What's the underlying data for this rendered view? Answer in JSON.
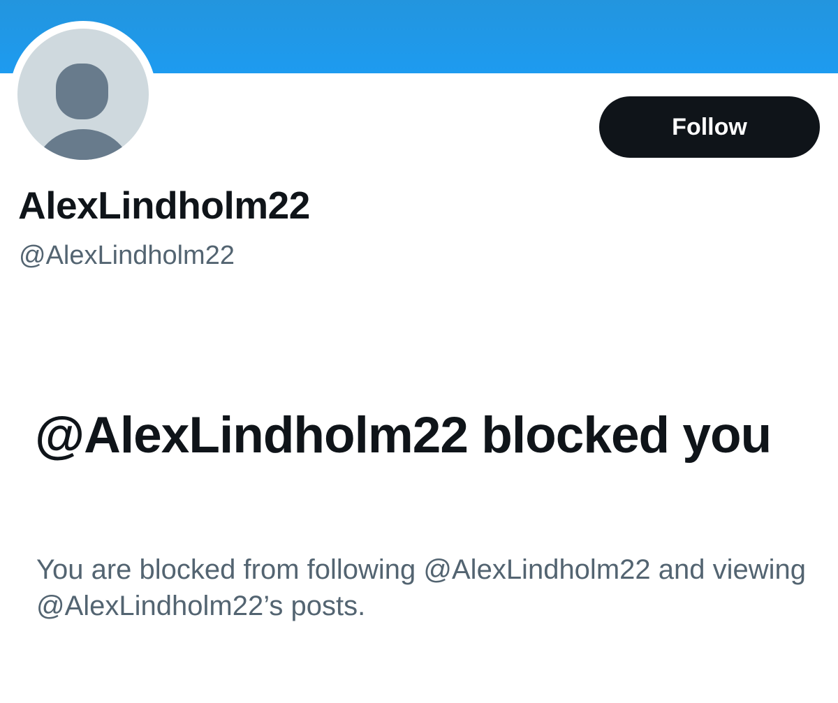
{
  "profile": {
    "display_name": "AlexLindholm22",
    "handle": "@AlexLindholm22",
    "follow_label": "Follow"
  },
  "blocked_notice": {
    "title": "@AlexLindholm22 blocked you",
    "description": "You are blocked from following @AlexLindholm22 and viewing @AlexLindholm22’s posts."
  },
  "colors": {
    "banner": "#1d9bf0",
    "avatar_bg": "#cfd9de",
    "avatar_silhouette": "#687b8c",
    "primary_text": "#0f1419",
    "secondary_text": "#536471",
    "button_bg": "#0f1419"
  },
  "icons": {
    "avatar": "default-profile-silhouette-icon"
  }
}
